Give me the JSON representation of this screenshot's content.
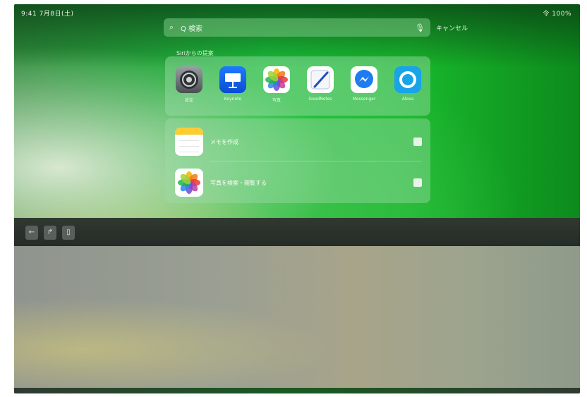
{
  "status": {
    "left": "9:41 7月8日(土)",
    "right": "令 100%"
  },
  "search": {
    "query": "Q 検索",
    "cancel_label": "キャンセル"
  },
  "section": {
    "apps_title": "Siriからの提案"
  },
  "apps": [
    {
      "label": "設定"
    },
    {
      "label": "Keynote"
    },
    {
      "label": "写真"
    },
    {
      "label": "GoodNotes"
    },
    {
      "label": "Messenger"
    },
    {
      "label": "Alexa"
    }
  ],
  "results": [
    {
      "title": "メモを作成",
      "icon": "notes-icon"
    },
    {
      "title": "写真を検索・閲覧する",
      "icon": "photos-icon"
    }
  ],
  "toolbar": {
    "back": "←",
    "forward": "↱",
    "doc": "▯"
  },
  "colors": {
    "accent_green": "#18b82c",
    "keynote_blue": "#1d7bff",
    "notes_yellow": "#ffcc33",
    "alexa_blue": "#19a3e8"
  }
}
